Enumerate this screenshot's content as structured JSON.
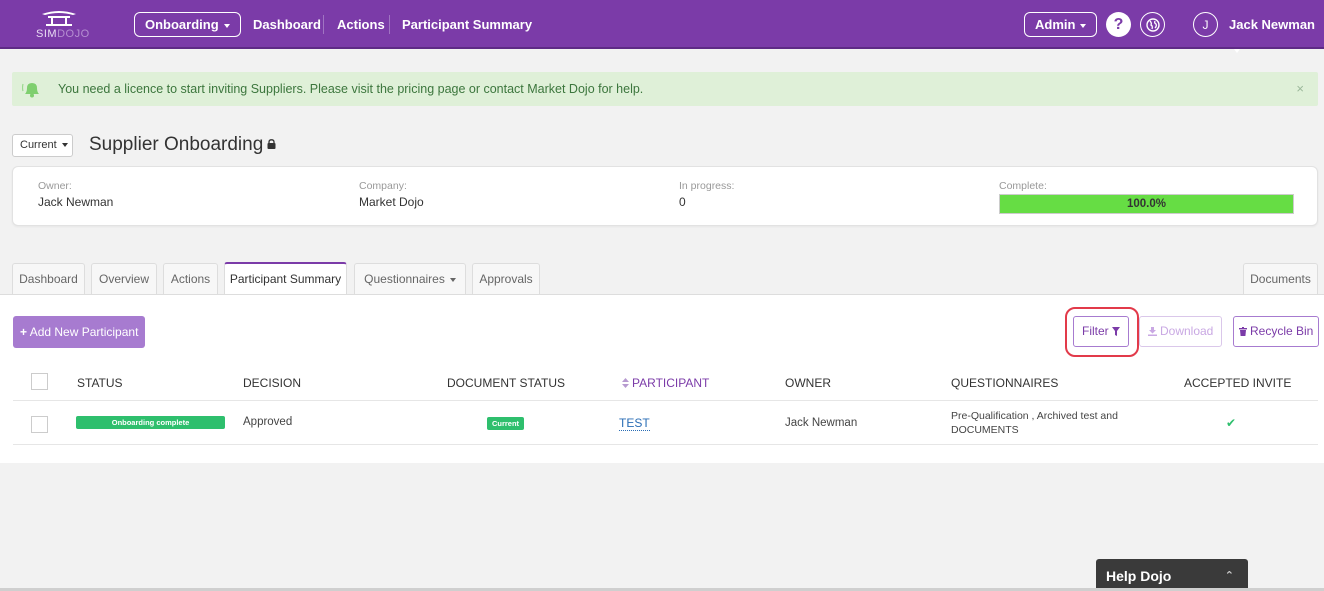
{
  "nav": {
    "logo_text_main": "SIM",
    "logo_text_dim": "DOJO",
    "onboarding_label": "Onboarding",
    "links": [
      "Dashboard",
      "Actions",
      "Participant Summary"
    ],
    "admin_label": "Admin",
    "help_glyph": "?",
    "user_initial": "J",
    "user_name": "Jack Newman"
  },
  "alert": {
    "text": "You need a licence to start inviting Suppliers. Please visit the pricing page or contact Market Dojo for help.",
    "close": "×"
  },
  "title_row": {
    "current_label": "Current",
    "title": "Supplier Onboarding"
  },
  "info": {
    "owner_label": "Owner:",
    "owner_value": "Jack Newman",
    "company_label": "Company:",
    "company_value": "Market Dojo",
    "in_progress_label": "In progress:",
    "in_progress_value": "0",
    "complete_label": "Complete:",
    "complete_value": "100.0%",
    "complete_fraction": 1.0
  },
  "tabs": [
    "Dashboard",
    "Overview",
    "Actions",
    "Participant Summary",
    "Questionnaires",
    "Approvals",
    "Documents"
  ],
  "active_tab": "Participant Summary",
  "toolbar": {
    "add_label": "Add New Participant",
    "filter_label": "Filter",
    "download_label": "Download",
    "recycle_label": "Recycle Bin"
  },
  "table": {
    "headers": [
      "STATUS",
      "DECISION",
      "DOCUMENT STATUS",
      "PARTICIPANT",
      "OWNER",
      "QUESTIONNAIRES",
      "ACCEPTED INVITE"
    ],
    "rows": [
      {
        "status": "Onboarding complete",
        "decision": "Approved",
        "document_status": "Current",
        "participant": "TEST",
        "owner": "Jack Newman",
        "questionnaires_line1": "Pre-Qualification , Archived test and",
        "questionnaires_line2": "DOCUMENTS",
        "accepted_invite": "✔"
      }
    ]
  },
  "help": {
    "label": "Help Dojo",
    "caret": "⌃"
  },
  "colors": {
    "brand": "#7b3ba8",
    "success": "#2ebf6d",
    "progress": "#66dd44",
    "alert_bg": "#dff0d8"
  }
}
